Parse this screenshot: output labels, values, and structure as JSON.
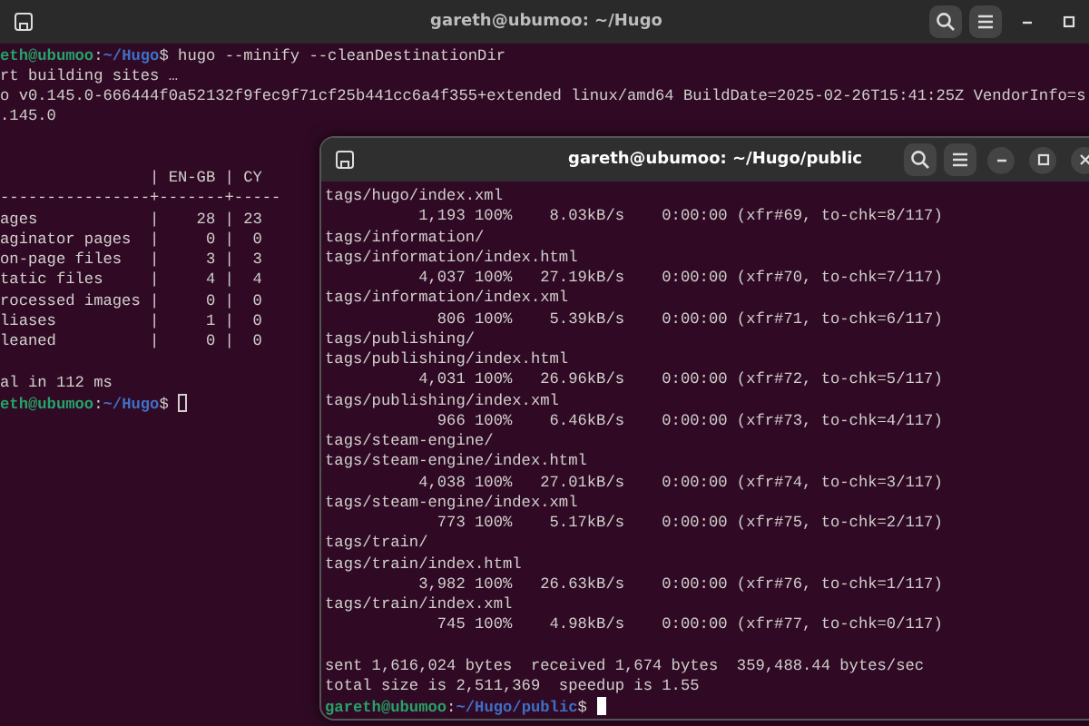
{
  "windows": [
    {
      "title": "gareth@ubumoo: ~/Hugo",
      "focused": false,
      "buttons": [
        {
          "kind": "new-tab"
        },
        {
          "kind": "search"
        },
        {
          "kind": "menu"
        },
        {
          "kind": "minimize"
        },
        {
          "kind": "maximize"
        }
      ],
      "lines": [
        {
          "kind": "prompt",
          "user": "eth@ubumoo",
          "colon": ":",
          "path": "~/Hugo",
          "symbol": "$",
          "command": "hugo --minify --cleanDestinationDir"
        },
        {
          "kind": "output",
          "text": "rt building sites …"
        },
        {
          "kind": "output",
          "text": "o v0.145.0-666444f0a52132f9fec9f71cf25b441cc6a4f355+extended linux/amd64 BuildDate=2025-02-26T15:41:25Z VendorInfo=s"
        },
        {
          "kind": "output",
          "text": ".145.0"
        },
        {
          "kind": "blank"
        },
        {
          "kind": "blank"
        },
        {
          "kind": "output",
          "text": "                | EN-GB | CY"
        },
        {
          "kind": "output",
          "text": "----------------+-------+-----"
        },
        {
          "kind": "output",
          "text": "ages            |    28 | 23"
        },
        {
          "kind": "output",
          "text": "aginator pages  |     0 |  0"
        },
        {
          "kind": "output",
          "text": "on-page files   |     3 |  3"
        },
        {
          "kind": "output",
          "text": "tatic files     |     4 |  4"
        },
        {
          "kind": "output",
          "text": "rocessed images |     0 |  0"
        },
        {
          "kind": "output",
          "text": "liases          |     1 |  0"
        },
        {
          "kind": "output",
          "text": "leaned          |     0 |  0"
        },
        {
          "kind": "blank"
        },
        {
          "kind": "output",
          "text": "al in 112 ms"
        },
        {
          "kind": "prompt",
          "user": "eth@ubumoo",
          "colon": ":",
          "path": "~/Hugo",
          "symbol": "$",
          "cursor": true
        }
      ]
    },
    {
      "title": "gareth@ubumoo: ~/Hugo/public",
      "focused": true,
      "buttons": [
        {
          "kind": "new-tab"
        },
        {
          "kind": "search"
        },
        {
          "kind": "menu"
        },
        {
          "kind": "minimize"
        },
        {
          "kind": "maximize"
        },
        {
          "kind": "close"
        }
      ],
      "lines": [
        {
          "kind": "output",
          "text": "tags/hugo/index.xml"
        },
        {
          "kind": "output",
          "text": "          1,193 100%    8.03kB/s    0:00:00 (xfr#69, to-chk=8/117)"
        },
        {
          "kind": "output",
          "text": "tags/information/"
        },
        {
          "kind": "output",
          "text": "tags/information/index.html"
        },
        {
          "kind": "output",
          "text": "          4,037 100%   27.19kB/s    0:00:00 (xfr#70, to-chk=7/117)"
        },
        {
          "kind": "output",
          "text": "tags/information/index.xml"
        },
        {
          "kind": "output",
          "text": "            806 100%    5.39kB/s    0:00:00 (xfr#71, to-chk=6/117)"
        },
        {
          "kind": "output",
          "text": "tags/publishing/"
        },
        {
          "kind": "output",
          "text": "tags/publishing/index.html"
        },
        {
          "kind": "output",
          "text": "          4,031 100%   26.96kB/s    0:00:00 (xfr#72, to-chk=5/117)"
        },
        {
          "kind": "output",
          "text": "tags/publishing/index.xml"
        },
        {
          "kind": "output",
          "text": "            966 100%    6.46kB/s    0:00:00 (xfr#73, to-chk=4/117)"
        },
        {
          "kind": "output",
          "text": "tags/steam-engine/"
        },
        {
          "kind": "output",
          "text": "tags/steam-engine/index.html"
        },
        {
          "kind": "output",
          "text": "          4,038 100%   27.01kB/s    0:00:00 (xfr#74, to-chk=3/117)"
        },
        {
          "kind": "output",
          "text": "tags/steam-engine/index.xml"
        },
        {
          "kind": "output",
          "text": "            773 100%    5.17kB/s    0:00:00 (xfr#75, to-chk=2/117)"
        },
        {
          "kind": "output",
          "text": "tags/train/"
        },
        {
          "kind": "output",
          "text": "tags/train/index.html"
        },
        {
          "kind": "output",
          "text": "          3,982 100%   26.63kB/s    0:00:00 (xfr#76, to-chk=1/117)"
        },
        {
          "kind": "output",
          "text": "tags/train/index.xml"
        },
        {
          "kind": "output",
          "text": "            745 100%    4.98kB/s    0:00:00 (xfr#77, to-chk=0/117)"
        },
        {
          "kind": "blank"
        },
        {
          "kind": "output",
          "text": "sent 1,616,024 bytes  received 1,674 bytes  359,488.44 bytes/sec"
        },
        {
          "kind": "output",
          "text": "total size is 2,511,369  speedup is 1.55"
        },
        {
          "kind": "prompt",
          "user": "gareth@ubumoo",
          "colon": ":",
          "path": "~/Hugo/public",
          "symbol": "$",
          "cursor": true
        }
      ]
    }
  ]
}
